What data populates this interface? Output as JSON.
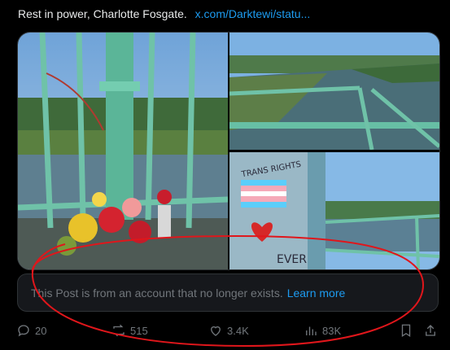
{
  "tweet": {
    "text": "Rest in power,  Charlotte Fosgate.",
    "link": "x.com/Darktewi/statu..."
  },
  "notice": {
    "text": "This Post is from an account that no longer exists.",
    "learn_more": "Learn more"
  },
  "actions": {
    "replies": "20",
    "reposts": "515",
    "likes": "3.4K",
    "views": "83K"
  },
  "image_text": {
    "sign_top": "TRANS RIGHTS",
    "sign_bottom": "EVER"
  },
  "colors": {
    "accent": "#1d9bf0",
    "muted": "#71767b",
    "annotation": "#e0161b"
  }
}
